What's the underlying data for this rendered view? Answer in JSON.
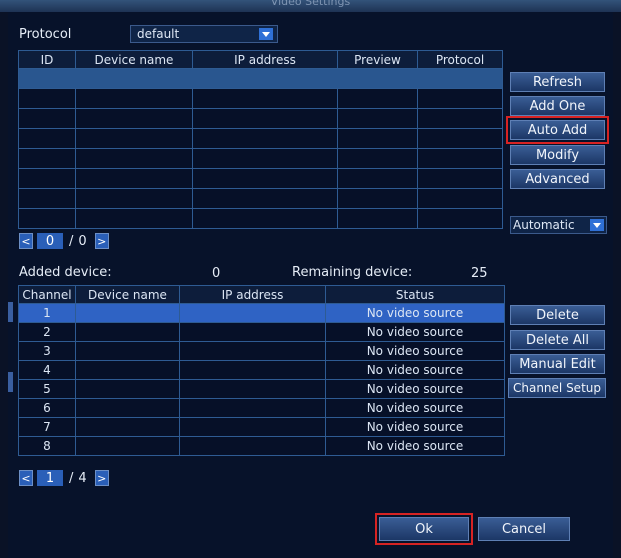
{
  "window": {
    "title": "Video Settings"
  },
  "protocol": {
    "label": "Protocol",
    "value": "default"
  },
  "ipc_table": {
    "headers": [
      "ID",
      "Device name",
      "IP address",
      "Preview",
      "Protocol"
    ],
    "row_count": 8
  },
  "side_buttons": {
    "refresh": "Refresh",
    "add_one": "Add One",
    "auto_add": "Auto Add",
    "modify": "Modify",
    "advanced": "Advanced",
    "mode": "Automatic"
  },
  "pager_top": {
    "prev": "<",
    "current": "0",
    "sep": "/",
    "total": "0",
    "next": ">"
  },
  "added": {
    "added_label": "Added device:",
    "added_count": "0",
    "remaining_label": "Remaining device:",
    "remaining_count": "25"
  },
  "channel_table": {
    "headers": [
      "Channel",
      "Device name",
      "IP address",
      "Status"
    ],
    "rows": [
      {
        "channel": "1",
        "status": "No video source"
      },
      {
        "channel": "2",
        "status": "No video source"
      },
      {
        "channel": "3",
        "status": "No video source"
      },
      {
        "channel": "4",
        "status": "No video source"
      },
      {
        "channel": "5",
        "status": "No video source"
      },
      {
        "channel": "6",
        "status": "No video source"
      },
      {
        "channel": "7",
        "status": "No video source"
      },
      {
        "channel": "8",
        "status": "No video source"
      }
    ]
  },
  "channel_buttons": {
    "delete": "Delete",
    "delete_all": "Delete All",
    "manual_edit": "Manual Edit",
    "channel_setup": "Channel Setup"
  },
  "pager_bottom": {
    "prev": "<",
    "current": "1",
    "sep": "/",
    "total": "4",
    "next": ">"
  },
  "footer": {
    "ok": "Ok",
    "cancel": "Cancel"
  },
  "colors": {
    "accent": "#2f70d6",
    "highlight_box": "#d72323",
    "selected_row": "#2f63c4"
  }
}
